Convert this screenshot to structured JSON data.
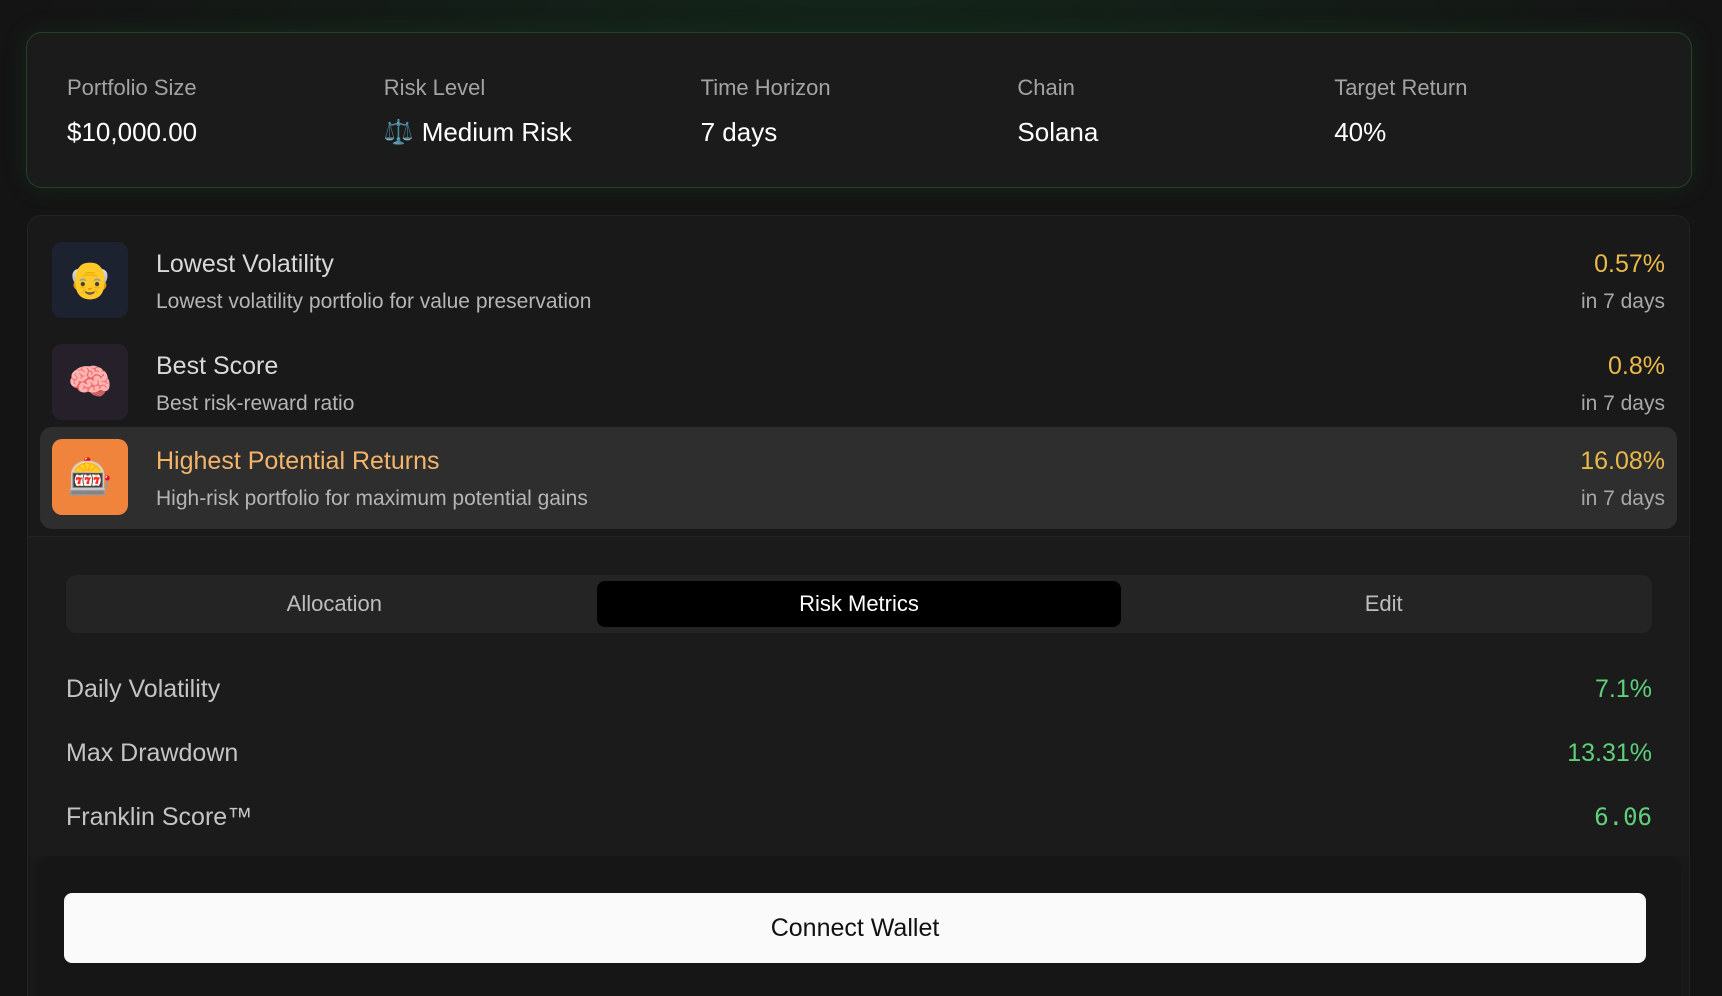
{
  "summary": {
    "portfolio_size": {
      "label": "Portfolio Size",
      "value": "$10,000.00"
    },
    "risk_level": {
      "label": "Risk Level",
      "icon": "⚖️",
      "value": "Medium Risk"
    },
    "time_horizon": {
      "label": "Time Horizon",
      "value": "7 days"
    },
    "chain": {
      "label": "Chain",
      "value": "Solana"
    },
    "target_return": {
      "label": "Target Return",
      "value": "40%"
    }
  },
  "strategies": [
    {
      "icon": "👴",
      "title": "Lowest Volatility",
      "description": "Lowest volatility portfolio for value preservation",
      "return": "0.57%",
      "period": "in 7 days"
    },
    {
      "icon": "🧠",
      "title": "Best Score",
      "description": "Best risk-reward ratio",
      "return": "0.8%",
      "period": "in 7 days"
    },
    {
      "icon": "🎰",
      "title": "Highest Potential Returns",
      "description": "High-risk portfolio for maximum potential gains",
      "return": "16.08%",
      "period": "in 7 days",
      "selected": true
    }
  ],
  "tabs": {
    "allocation": "Allocation",
    "risk_metrics": "Risk Metrics",
    "edit": "Edit",
    "active": "risk_metrics"
  },
  "metrics": [
    {
      "label": "Daily Volatility",
      "value": "7.1%"
    },
    {
      "label": "Max Drawdown",
      "value": "13.31%"
    },
    {
      "label": "Franklin Score™",
      "value": "6.06"
    }
  ],
  "connect_wallet_label": "Connect Wallet",
  "colors": {
    "return_yellow": "#e9b949",
    "metric_green": "#5fcf7a",
    "selected_title": "#f4b46a",
    "slot_icon_bg": "#f0843c"
  }
}
